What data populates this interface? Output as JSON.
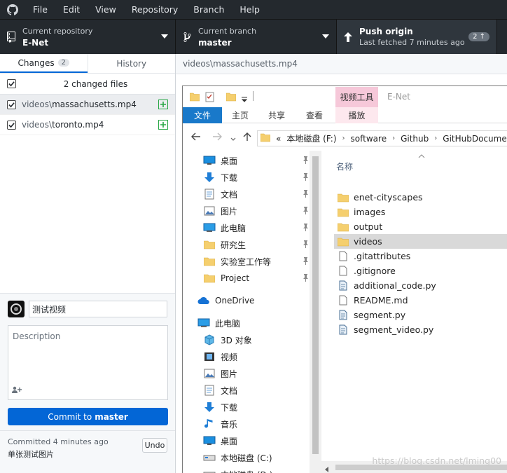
{
  "menu": [
    "File",
    "Edit",
    "View",
    "Repository",
    "Branch",
    "Help"
  ],
  "toolbar": {
    "repo_label": "Current repository",
    "repo_name": "E-Net",
    "branch_label": "Current branch",
    "branch_name": "master",
    "push_label": "Push origin",
    "push_sub": "Last fetched 7 minutes ago",
    "push_badge": "2 ↑"
  },
  "tabs": {
    "changes": "Changes",
    "changes_count": "2",
    "history": "History"
  },
  "changes": {
    "header": "2 changed files",
    "files": [
      {
        "dir": "videos\\",
        "name": "massachusetts.mp4"
      },
      {
        "dir": "videos\\",
        "name": "toronto.mp4"
      }
    ]
  },
  "commit": {
    "summary_value": "测试视频",
    "description_placeholder": "Description",
    "button_prefix": "Commit to",
    "button_branch": "master"
  },
  "last_commit": {
    "time": "Committed 4 minutes ago",
    "message": "单张测试图片",
    "undo": "Undo"
  },
  "diff": {
    "path": "videos\\massachusetts.mp4"
  },
  "explorer": {
    "ribbon_context": "视频工具",
    "window_title": "E-Net",
    "ribbon_tabs": {
      "file": "文件",
      "home": "主页",
      "share": "共享",
      "view": "查看",
      "play": "播放"
    },
    "address": [
      "«",
      "本地磁盘 (F:)",
      "software",
      "Github",
      "GitHubDocume"
    ],
    "column_name": "名称",
    "nav": [
      {
        "label": "桌面",
        "icon": "desktop-icon",
        "pinned": true
      },
      {
        "label": "下载",
        "icon": "download-icon",
        "pinned": true
      },
      {
        "label": "文档",
        "icon": "document-icon",
        "pinned": true
      },
      {
        "label": "图片",
        "icon": "picture-icon",
        "pinned": true
      },
      {
        "label": "此电脑",
        "icon": "computer-icon",
        "pinned": true
      },
      {
        "label": "研究生",
        "icon": "folder-icon",
        "pinned": true
      },
      {
        "label": "实验室工作等",
        "icon": "folder-icon",
        "pinned": true
      },
      {
        "label": "Project",
        "icon": "folder-icon",
        "pinned": true
      },
      {
        "label": "OneDrive",
        "icon": "cloud-icon",
        "pinned": false
      },
      {
        "label": "此电脑",
        "icon": "computer-icon",
        "pinned": false
      },
      {
        "label": "3D 对象",
        "icon": "cube-icon",
        "pinned": false
      },
      {
        "label": "视频",
        "icon": "video-icon",
        "pinned": false
      },
      {
        "label": "图片",
        "icon": "picture-icon",
        "pinned": false
      },
      {
        "label": "文档",
        "icon": "document-icon",
        "pinned": false
      },
      {
        "label": "下载",
        "icon": "download-icon",
        "pinned": false
      },
      {
        "label": "音乐",
        "icon": "music-icon",
        "pinned": false
      },
      {
        "label": "桌面",
        "icon": "desktop-icon",
        "pinned": false
      },
      {
        "label": "本地磁盘 (C:)",
        "icon": "drive-icon",
        "pinned": false
      },
      {
        "label": "本地磁盘 (D:)",
        "icon": "drive-icon",
        "pinned": false
      }
    ],
    "files": [
      {
        "name": "enet-cityscapes",
        "icon": "folder-icon"
      },
      {
        "name": "images",
        "icon": "folder-icon"
      },
      {
        "name": "output",
        "icon": "folder-icon"
      },
      {
        "name": "videos",
        "icon": "folder-icon",
        "selected": true
      },
      {
        "name": ".gitattributes",
        "icon": "file-icon"
      },
      {
        "name": ".gitignore",
        "icon": "file-icon"
      },
      {
        "name": "additional_code.py",
        "icon": "python-file-icon"
      },
      {
        "name": "README.md",
        "icon": "file-icon"
      },
      {
        "name": "segment.py",
        "icon": "python-file-icon"
      },
      {
        "name": "segment_video.py",
        "icon": "python-file-icon"
      }
    ]
  },
  "watermark": "https://blog.csdn.net/lming00",
  "colors": {
    "titlebar": "#24292e",
    "accent": "#0366d6",
    "added": "#28a745",
    "explorer_file_tab": "#1979ca",
    "video_tools": "#f6c8d9",
    "folder": "#f5cf6e"
  }
}
